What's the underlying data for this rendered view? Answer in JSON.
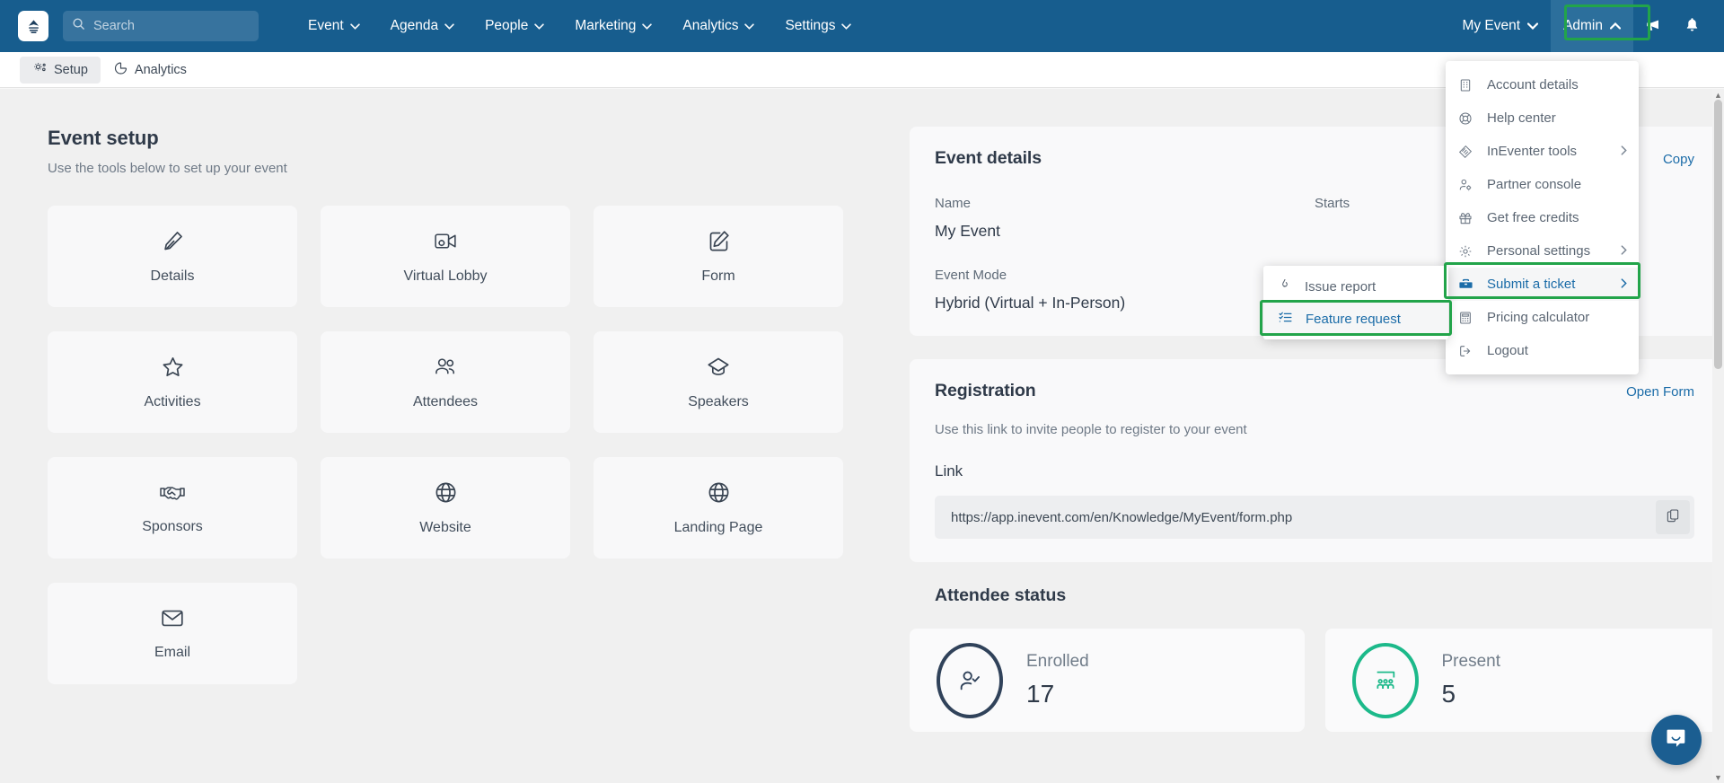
{
  "topbar": {
    "logo_icon": "inevent-logo-icon",
    "search_placeholder": "Search",
    "nav_items": [
      {
        "label": "Event"
      },
      {
        "label": "Agenda"
      },
      {
        "label": "People"
      },
      {
        "label": "Marketing"
      },
      {
        "label": "Analytics"
      },
      {
        "label": "Settings"
      }
    ],
    "right": {
      "event_selector": "My Event",
      "admin_label": "Admin",
      "announcement_icon": "megaphone-icon",
      "notification_icon": "bell-icon"
    }
  },
  "subbar": {
    "tabs": [
      {
        "label": "Setup",
        "icon": "gears-icon",
        "active": true
      },
      {
        "label": "Analytics",
        "icon": "pie-chart-icon",
        "active": false
      }
    ]
  },
  "setup": {
    "title": "Event setup",
    "subtitle": "Use the tools below to set up your event",
    "cards": [
      {
        "label": "Details",
        "icon": "pencil-icon"
      },
      {
        "label": "Virtual Lobby",
        "icon": "video-camera-icon"
      },
      {
        "label": "Form",
        "icon": "form-edit-icon"
      },
      {
        "label": "Activities",
        "icon": "star-icon"
      },
      {
        "label": "Attendees",
        "icon": "people-icon"
      },
      {
        "label": "Speakers",
        "icon": "graduation-cap-icon"
      },
      {
        "label": "Sponsors",
        "icon": "handshake-icon"
      },
      {
        "label": "Website",
        "icon": "globe-icon"
      },
      {
        "label": "Landing Page",
        "icon": "globe-icon"
      },
      {
        "label": "Email",
        "icon": "envelope-icon"
      }
    ]
  },
  "event_details": {
    "title": "Event details",
    "copy_label": "Copy",
    "name_label": "Name",
    "name_value": "My Event",
    "mode_label": "Event Mode",
    "mode_value": "Hybrid (Virtual + In-Person)",
    "starts_label": "Starts"
  },
  "registration": {
    "title": "Registration",
    "open_form_label": "Open Form",
    "description": "Use this link to invite people to register to your event",
    "link_label": "Link",
    "link_value": "https://app.inevent.com/en/Knowledge/MyEvent/form.php",
    "copy_icon": "copy-icon"
  },
  "attendee_status": {
    "title": "Attendee status",
    "stats": [
      {
        "label": "Enrolled",
        "value": "17",
        "icon": "user-check-icon",
        "color": "#30425a"
      },
      {
        "label": "Present",
        "value": "5",
        "icon": "audience-icon",
        "color": "#1cb98a"
      }
    ]
  },
  "admin_menu": {
    "items": [
      {
        "label": "Account details",
        "icon": "building-icon",
        "submenu": false,
        "highlighted": false
      },
      {
        "label": "Help center",
        "icon": "lifebuoy-icon",
        "submenu": false,
        "highlighted": false
      },
      {
        "label": "InEventer tools",
        "icon": "tools-badge-icon",
        "submenu": true,
        "highlighted": false
      },
      {
        "label": "Partner console",
        "icon": "user-gear-icon",
        "submenu": false,
        "highlighted": false
      },
      {
        "label": "Get free credits",
        "icon": "gift-icon",
        "submenu": false,
        "highlighted": false
      },
      {
        "label": "Personal settings",
        "icon": "gear-icon",
        "submenu": true,
        "highlighted": false
      },
      {
        "label": "Submit a ticket",
        "icon": "toolbox-icon",
        "submenu": true,
        "highlighted": true
      },
      {
        "label": "Pricing calculator",
        "icon": "calculator-icon",
        "submenu": false,
        "highlighted": false
      },
      {
        "label": "Logout",
        "icon": "logout-icon",
        "submenu": false,
        "highlighted": false
      }
    ]
  },
  "ticket_submenu": {
    "items": [
      {
        "label": "Issue report",
        "icon": "flame-icon",
        "highlighted": false
      },
      {
        "label": "Feature request",
        "icon": "checklist-icon",
        "highlighted": true
      }
    ]
  },
  "chat": {
    "icon": "chat-smile-icon"
  },
  "colors": {
    "navbar": "#175d8e",
    "highlight_green": "#22a44a",
    "link_blue": "#1b6ca8",
    "teal": "#1cb98a",
    "dark_navy": "#30425a"
  }
}
